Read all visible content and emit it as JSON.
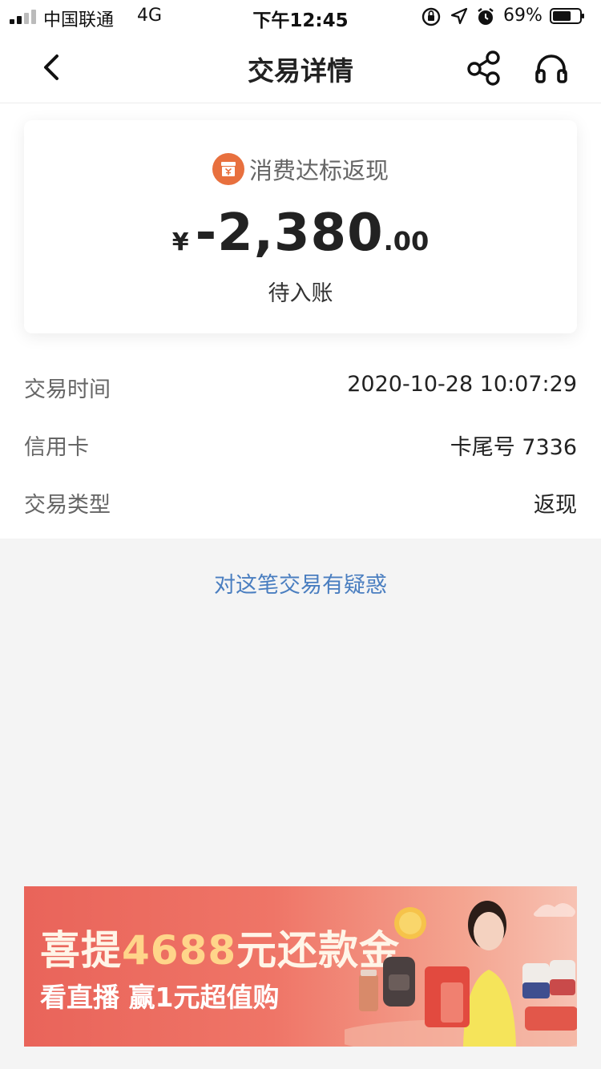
{
  "status_bar": {
    "carrier": "中国联通",
    "network": "4G",
    "time": "下午12:45",
    "battery_percent": "69%",
    "battery_level": 0.69
  },
  "nav": {
    "title": "交易详情",
    "icons": [
      "back-icon",
      "share-icon",
      "headset-icon"
    ]
  },
  "summary": {
    "category_icon": "gift-box-icon",
    "category": "消费达标返现",
    "currency": "¥",
    "amount_int": "-2,380",
    "amount_dec": ".00",
    "status": "待入账"
  },
  "details": [
    {
      "label": "交易时间",
      "value": "2020-10-28 10:07:29"
    },
    {
      "label": "信用卡",
      "value": "卡尾号 7336"
    },
    {
      "label": "交易类型",
      "value": "返现"
    }
  ],
  "doubt_link": "对这笔交易有疑惑",
  "banner": {
    "title_prefix": "喜提",
    "title_amount": "4688",
    "title_suffix": "元还款金",
    "subtitle": "看直播 赢1元超值购"
  },
  "colors": {
    "accent_orange": "#e8703e",
    "link_blue": "#4a7ec0",
    "banner_red": "#e9645a"
  }
}
